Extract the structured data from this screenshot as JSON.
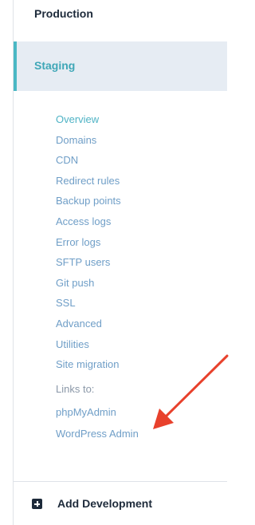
{
  "environments": {
    "production_label": "Production",
    "staging_label": "Staging"
  },
  "submenu": {
    "items": [
      "Overview",
      "Domains",
      "CDN",
      "Redirect rules",
      "Backup points",
      "Access logs",
      "Error logs",
      "SFTP users",
      "Git push",
      "SSL",
      "Advanced",
      "Utilities",
      "Site migration"
    ],
    "active_item": "Overview"
  },
  "links": {
    "heading": "Links to:",
    "phpmyadmin": "phpMyAdmin",
    "wordpress_admin": "WordPress Admin"
  },
  "footer": {
    "add_development_label": "Add Development"
  },
  "colors": {
    "accent": "#4ab8c4",
    "link": "#6f9ec7",
    "active_bg": "#e6ecf3",
    "annotation_arrow": "#e8412c"
  },
  "icons": {
    "add": "plus-square-icon",
    "annotation": "red-arrow-annotation"
  }
}
